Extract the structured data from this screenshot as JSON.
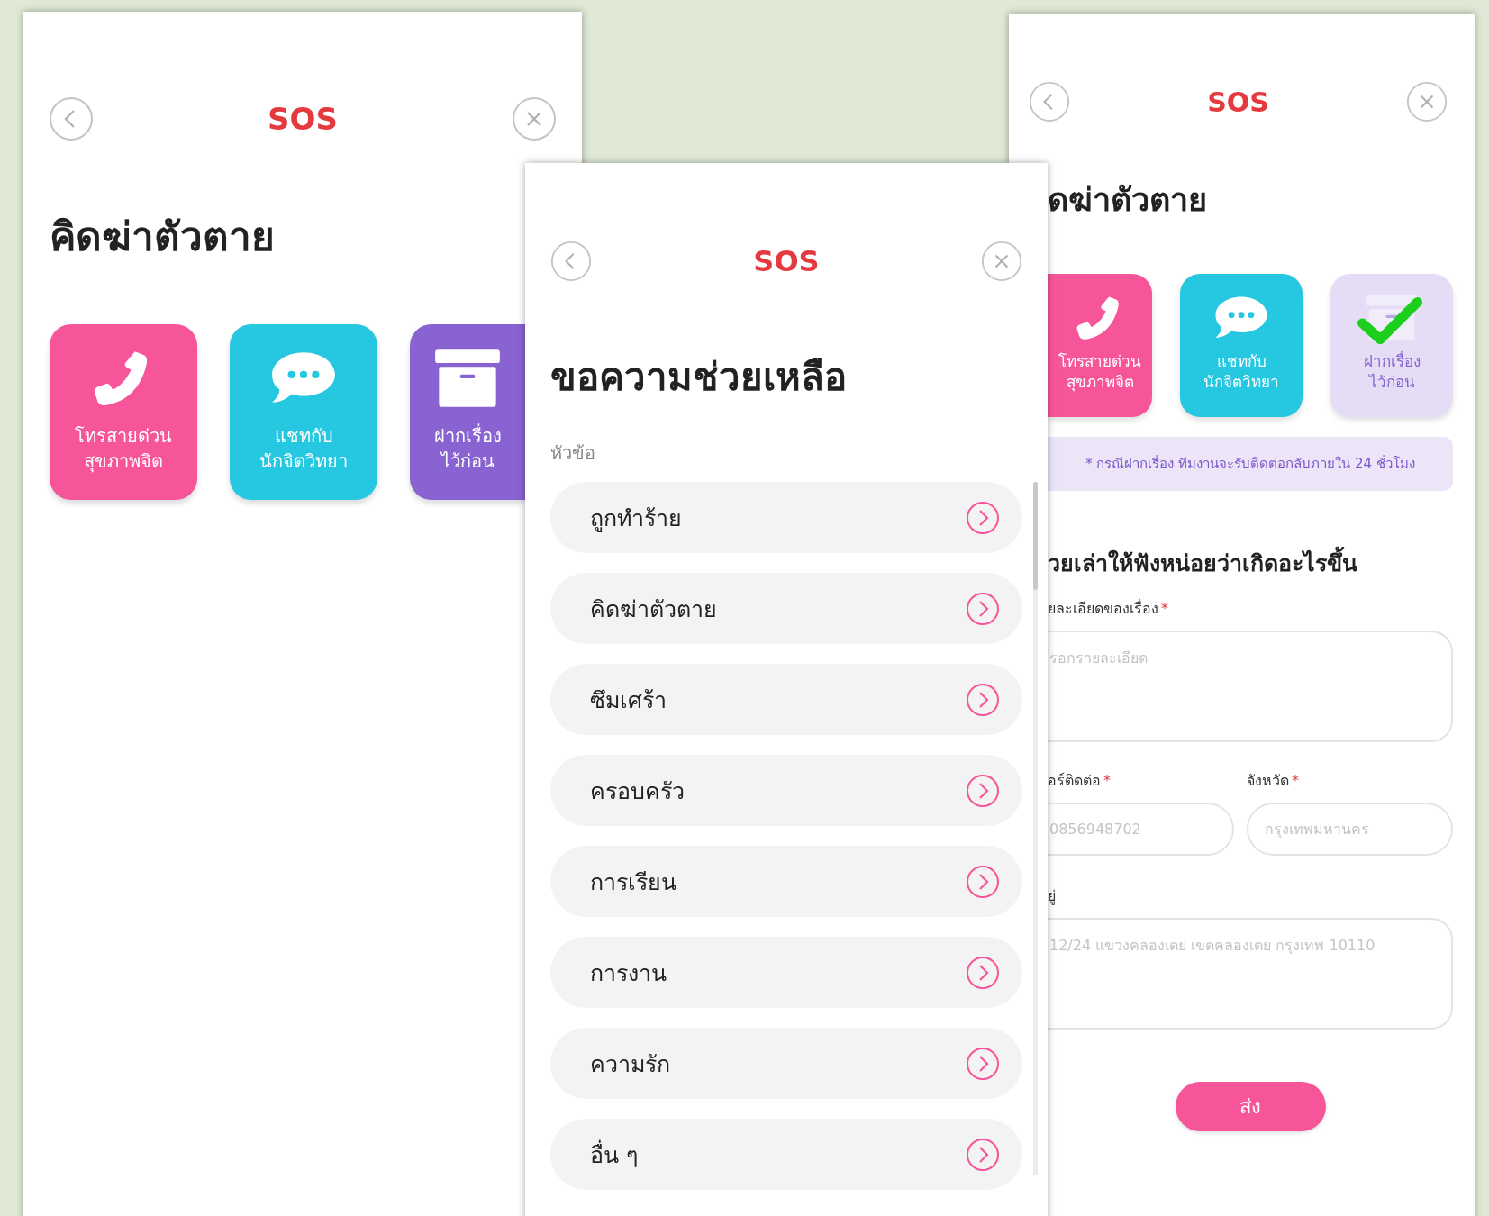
{
  "left_screen": {
    "header": {
      "title": "SOS"
    },
    "heading": "คิดฆ่าตัวตาย",
    "options": [
      {
        "kind": "phone",
        "color": "#f7559a",
        "lines": [
          "โทรสายด่วน",
          "สุขภาพจิต"
        ]
      },
      {
        "kind": "chat",
        "color": "#25c8e0",
        "lines": [
          "แชทกับ",
          "นักจิตวิทยา"
        ]
      },
      {
        "kind": "archive",
        "color": "#8a63d2",
        "lines": [
          "ฝากเรื่อง",
          "ไว้ก่อน"
        ]
      }
    ]
  },
  "middle_screen": {
    "header": {
      "title": "SOS"
    },
    "heading": "ขอความช่วยเหลือ",
    "section_label": "หัวข้อ",
    "topics": [
      {
        "label": "ถูกทำร้าย"
      },
      {
        "label": "คิดฆ่าตัวตาย"
      },
      {
        "label": "ซึมเศร้า"
      },
      {
        "label": "ครอบครัว"
      },
      {
        "label": "การเรียน"
      },
      {
        "label": "การงาน"
      },
      {
        "label": "ความรัก"
      },
      {
        "label": "อื่น ๆ"
      }
    ]
  },
  "right_screen": {
    "header": {
      "title": "SOS"
    },
    "heading": "ดฆ่าตัวตาย",
    "options": [
      {
        "kind": "phone",
        "color": "#f7559a",
        "selected": false,
        "lines": [
          "โทรสายด่วน",
          "สุขภาพจิต"
        ]
      },
      {
        "kind": "chat",
        "color": "#25c8e0",
        "selected": false,
        "lines": [
          "แชทกับ",
          "นักจิตวิทยา"
        ]
      },
      {
        "kind": "archive",
        "color": "#8a63d2",
        "selected": true,
        "lines": [
          "ฝากเรื่อง",
          "ไว้ก่อน"
        ]
      }
    ],
    "notice": "* กรณีฝากเรื่อง ทีมงานจะรับติดต่อกลับภายใน 24 ชั่วโมง",
    "form_heading": "วยเล่าให้ฟังหน่อยว่าเกิดอะไรขึ้น",
    "fields": [
      {
        "kind": "textarea",
        "label": "ยละเอียดของเรื่อง",
        "required_mark": "*",
        "placeholder": "รอกรายละเอียด"
      },
      {
        "kind": "input",
        "label": "อร์ติดต่อ",
        "required_mark": "*",
        "placeholder": "0856948702"
      },
      {
        "kind": "input",
        "label": "จังหวัด",
        "required_mark": "*",
        "placeholder": "กรุงเทพมหานคร"
      },
      {
        "kind": "textarea",
        "label": "ยู่",
        "placeholder": "12/24 แขวงคลองเตย เขตคลองเตย กรุงเทพ 10110"
      }
    ],
    "submit": "ส่ง"
  }
}
